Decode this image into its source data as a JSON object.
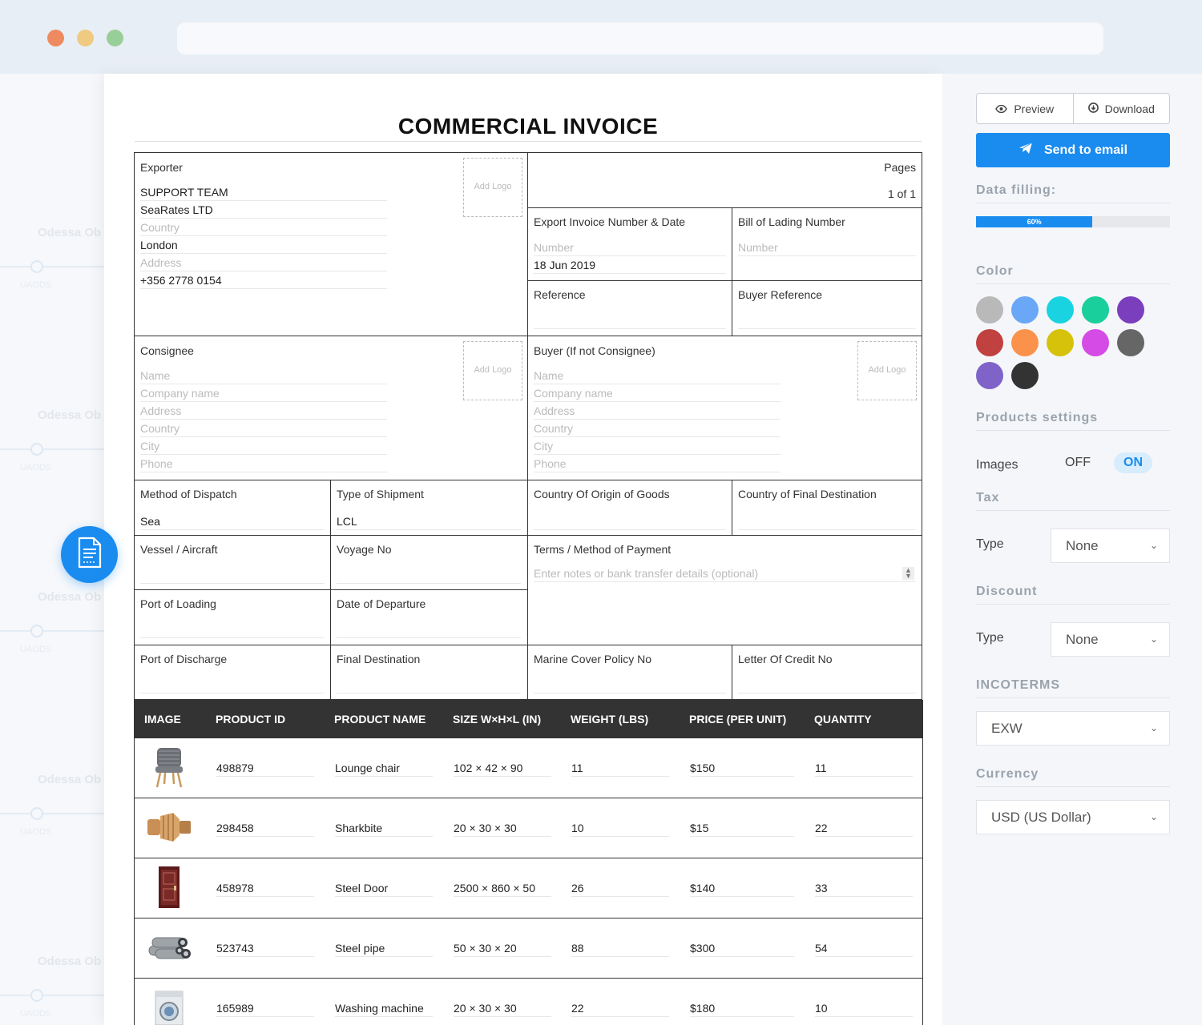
{
  "document": {
    "title": "COMMERCIAL INVOICE",
    "add_logo": "Add Logo",
    "exporter": {
      "label": "Exporter",
      "lines": [
        {
          "text": "SUPPORT TEAM",
          "placeholder": false
        },
        {
          "text": "SeaRates LTD",
          "placeholder": false
        },
        {
          "text": "Country",
          "placeholder": true
        },
        {
          "text": "London",
          "placeholder": false
        },
        {
          "text": "Address",
          "placeholder": true
        },
        {
          "text": "+356 2778 0154",
          "placeholder": false
        }
      ]
    },
    "pages": {
      "label": "Pages",
      "value": "1 of 1"
    },
    "export_invoice": {
      "label": "Export Invoice Number & Date",
      "number_placeholder": "Number",
      "date": "18 Jun 2019"
    },
    "bill_of_lading": {
      "label": "Bill of Lading Number",
      "number_placeholder": "Number"
    },
    "reference": {
      "label": "Reference"
    },
    "buyer_reference": {
      "label": "Buyer Reference"
    },
    "consignee": {
      "label": "Consignee",
      "lines": [
        "Name",
        "Company name",
        "Address",
        "Country",
        "City",
        "Phone"
      ]
    },
    "buyer": {
      "label": "Buyer (If not Consignee)",
      "lines": [
        "Name",
        "Company name",
        "Address",
        "Country",
        "City",
        "Phone"
      ]
    },
    "method_of_dispatch": {
      "label": "Method of Dispatch",
      "value": "Sea"
    },
    "type_of_shipment": {
      "label": "Type of Shipment",
      "value": "LCL"
    },
    "country_of_origin": {
      "label": "Country Of Origin of Goods"
    },
    "country_final_destination": {
      "label": "Country of Final Destination"
    },
    "vessel": {
      "label": "Vessel / Aircraft"
    },
    "voyage_no": {
      "label": "Voyage No"
    },
    "terms": {
      "label": "Terms / Method of Payment",
      "placeholder": "Enter notes or bank transfer details (optional)"
    },
    "port_of_loading": {
      "label": "Port of Loading"
    },
    "date_of_departure": {
      "label": "Date of Departure"
    },
    "port_of_discharge": {
      "label": "Port of Discharge"
    },
    "final_destination": {
      "label": "Final Destination"
    },
    "marine_cover": {
      "label": "Marine Cover Policy No"
    },
    "letter_of_credit": {
      "label": "Letter Of Credit No"
    }
  },
  "products": {
    "columns": [
      "IMAGE",
      "PRODUCT ID",
      "PRODUCT NAME",
      "SIZE W×H×L (IN)",
      "WEIGHT (LBS)",
      "PRICE (PER UNIT)",
      "QUANTITY"
    ],
    "rows": [
      {
        "image": "lounge-chair-image",
        "id": "498879",
        "name": "Lounge chair",
        "size": "102 × 42 × 90",
        "weight": "11",
        "price": "$150",
        "quantity": "11"
      },
      {
        "image": "sharkbite-fitting-image",
        "id": "298458",
        "name": "Sharkbite",
        "size": "20 × 30 × 30",
        "weight": "10",
        "price": "$15",
        "quantity": "22"
      },
      {
        "image": "steel-door-image",
        "id": "458978",
        "name": "Steel Door",
        "size": "2500 × 860 × 50",
        "weight": "26",
        "price": "$140",
        "quantity": "33"
      },
      {
        "image": "steel-pipe-image",
        "id": "523743",
        "name": "Steel pipe",
        "size": "50 × 30 × 20",
        "weight": "88",
        "price": "$300",
        "quantity": "54"
      },
      {
        "image": "washing-machine-image",
        "id": "165989",
        "name": "Washing machine",
        "size": "20 × 30 × 30",
        "weight": "22",
        "price": "$180",
        "quantity": "10"
      }
    ]
  },
  "left_strip": {
    "ghost_label": "Odessa Ob",
    "ghost_code": "UAODS"
  },
  "sidebar": {
    "preview_label": "Preview",
    "download_label": "Download",
    "send_label": "Send to email",
    "data_filling": {
      "label": "Data filling:",
      "value": "60%",
      "fraction": 0.6
    },
    "color": {
      "label": "Color",
      "swatches": [
        "#b9b9b9",
        "#6aa8f7",
        "#19d3e0",
        "#19cf9c",
        "#7b3fbe",
        "#c0413f",
        "#fb924b",
        "#d6c20b",
        "#d54be6",
        "#666666",
        "#8063c9",
        "#333333"
      ]
    },
    "products_settings": {
      "label": "Products settings",
      "images_label": "Images",
      "off": "OFF",
      "on": "ON"
    },
    "tax": {
      "label": "Tax",
      "type_label": "Type",
      "value": "None"
    },
    "discount": {
      "label": "Discount",
      "type_label": "Type",
      "value": "None"
    },
    "incoterms": {
      "label": "INCOTERMS",
      "value": "EXW"
    },
    "currency": {
      "label": "Currency",
      "value": "USD (US Dollar)"
    },
    "accent": "#1a8cf0"
  }
}
